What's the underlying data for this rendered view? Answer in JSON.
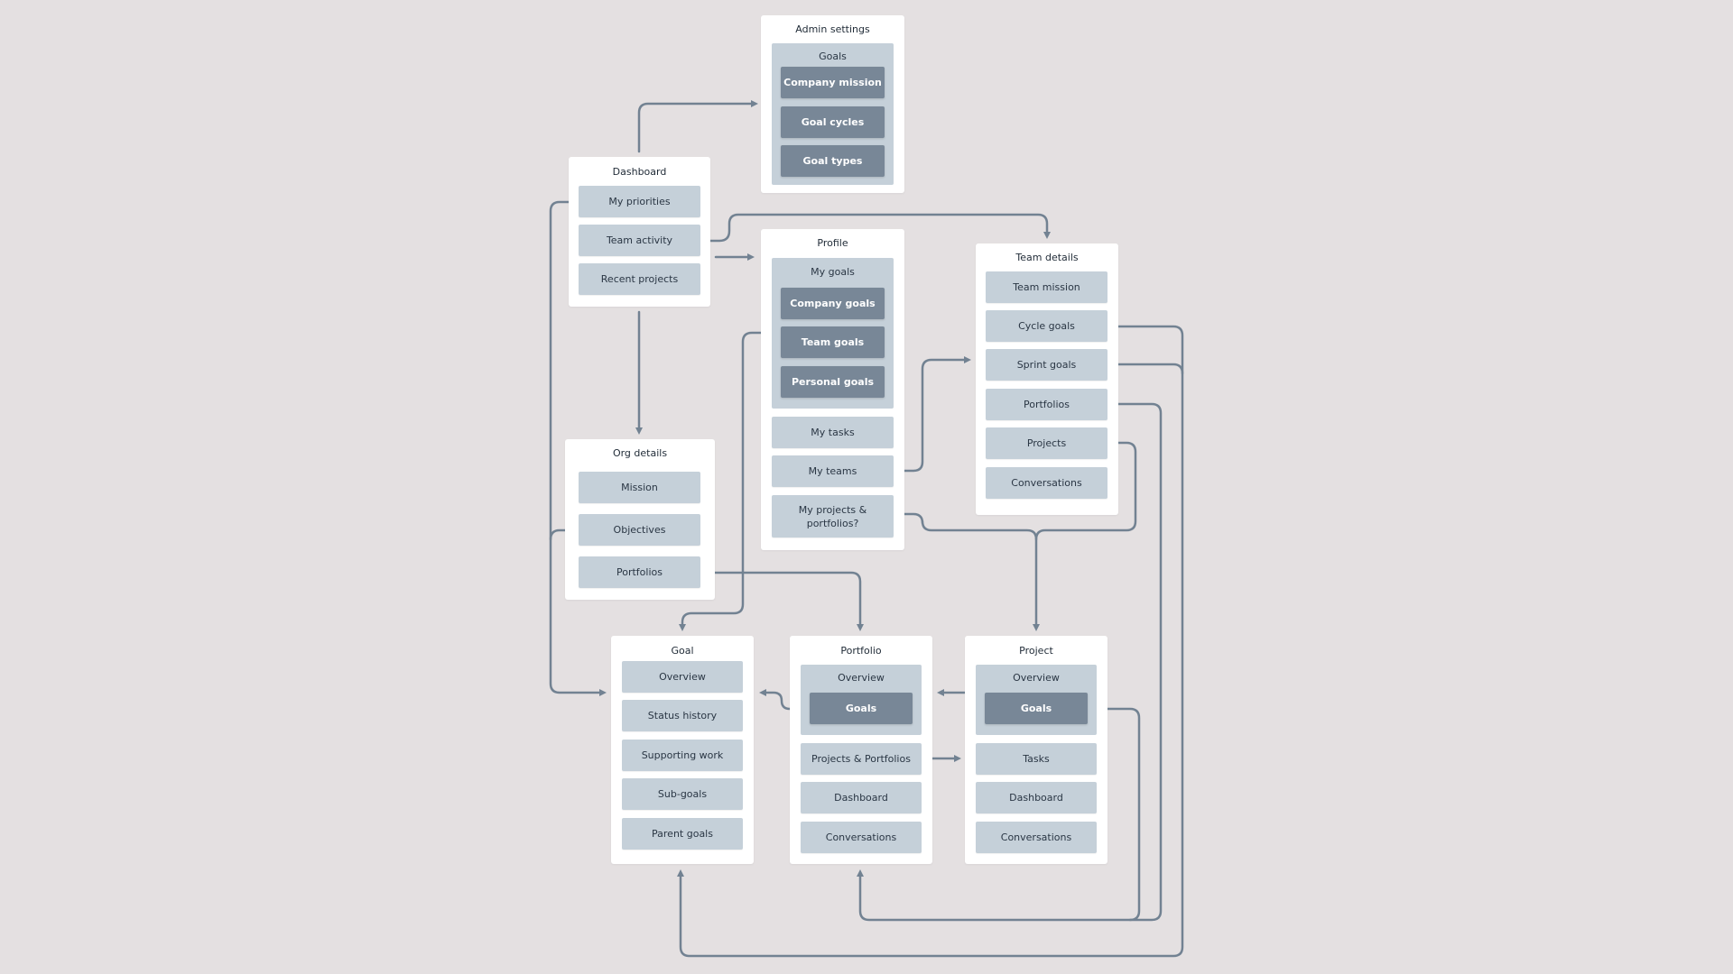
{
  "colors": {
    "background": "#e4e0e1",
    "card": "#ffffff",
    "item": "#c5d0d9",
    "item_dark": "#788797",
    "connector": "#728292"
  },
  "admin_settings": {
    "title": "Admin settings",
    "group_title": "Goals",
    "items": [
      "Company mission",
      "Goal cycles",
      "Goal types"
    ]
  },
  "dashboard": {
    "title": "Dashboard",
    "items": [
      "My priorities",
      "Team activity",
      "Recent projects"
    ]
  },
  "profile": {
    "title": "Profile",
    "group_title": "My goals",
    "group_items": [
      "Company goals",
      "Team goals",
      "Personal goals"
    ],
    "items": [
      "My tasks",
      "My teams",
      "My projects & portfolios?"
    ]
  },
  "team_details": {
    "title": "Team details",
    "items": [
      "Team mission",
      "Cycle goals",
      "Sprint goals",
      "Portfolios",
      "Projects",
      "Conversations"
    ]
  },
  "org_details": {
    "title": "Org details",
    "items": [
      "Mission",
      "Objectives",
      "Portfolios"
    ]
  },
  "goal": {
    "title": "Goal",
    "items": [
      "Overview",
      "Status history",
      "Supporting work",
      "Sub-goals",
      "Parent goals"
    ]
  },
  "portfolio": {
    "title": "Portfolio",
    "group_title": "Overview",
    "group_items": [
      "Goals"
    ],
    "items": [
      "Projects & Portfolios",
      "Dashboard",
      "Conversations"
    ]
  },
  "project": {
    "title": "Project",
    "group_title": "Overview",
    "group_items": [
      "Goals"
    ],
    "items": [
      "Tasks",
      "Dashboard",
      "Conversations"
    ]
  }
}
